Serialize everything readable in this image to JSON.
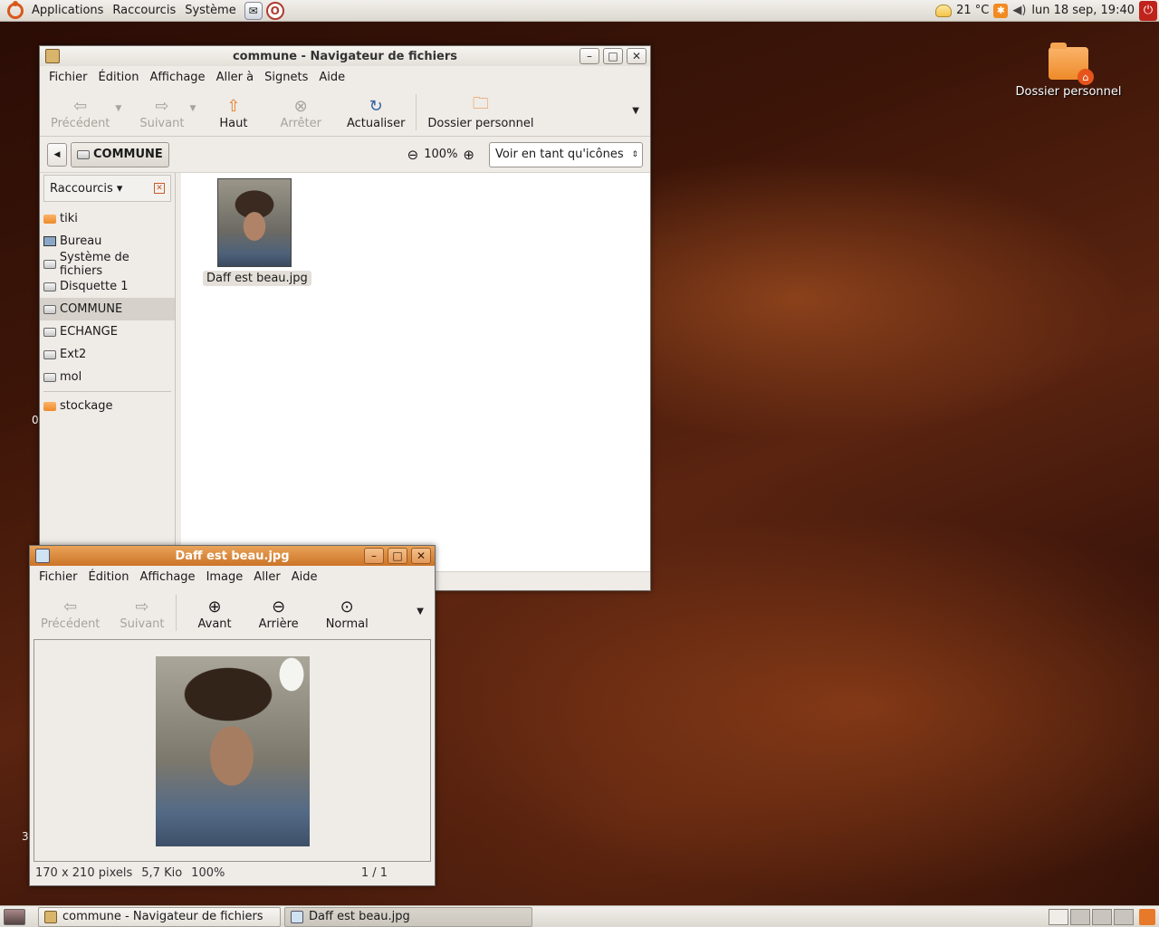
{
  "top_panel": {
    "menus": [
      "Applications",
      "Raccourcis",
      "Système"
    ],
    "weather": "21 °C",
    "clock": "lun 18 sep, 19:40"
  },
  "desktop": {
    "home_icon_label": "Dossier personnel",
    "stray_chars": [
      "0",
      "3"
    ]
  },
  "file_manager": {
    "title": "commune - Navigateur de fichiers",
    "menus": [
      "Fichier",
      "Édition",
      "Affichage",
      "Aller à",
      "Signets",
      "Aide"
    ],
    "toolbar": {
      "back": "Précédent",
      "forward": "Suivant",
      "up": "Haut",
      "stop": "Arrêter",
      "reload": "Actualiser",
      "home": "Dossier personnel"
    },
    "location": "COMMUNE",
    "zoom": "100%",
    "view_mode": "Voir en tant qu'icônes",
    "sidebar_title": "Raccourcis",
    "sidebar_items": [
      "tiki",
      "Bureau",
      "Système de fichiers",
      "Disquette 1",
      "COMMUNE",
      "ECHANGE",
      "Ext2",
      "mol"
    ],
    "sidebar_bookmarks": [
      "stockage"
    ],
    "files": [
      {
        "name": "Daff est beau.jpg"
      }
    ]
  },
  "image_viewer": {
    "title": "Daff est beau.jpg",
    "menus": [
      "Fichier",
      "Édition",
      "Affichage",
      "Image",
      "Aller",
      "Aide"
    ],
    "toolbar": {
      "prev": "Précédent",
      "next": "Suivant",
      "zoom_in": "Avant",
      "zoom_out": "Arrière",
      "normal": "Normal"
    },
    "status": {
      "dimensions": "170 x 210 pixels",
      "size": "5,7 Kio",
      "zoom": "100%",
      "page": "1 / 1"
    }
  },
  "taskbar": {
    "tasks": [
      "commune - Navigateur de fichiers",
      "Daff est beau.jpg"
    ]
  }
}
